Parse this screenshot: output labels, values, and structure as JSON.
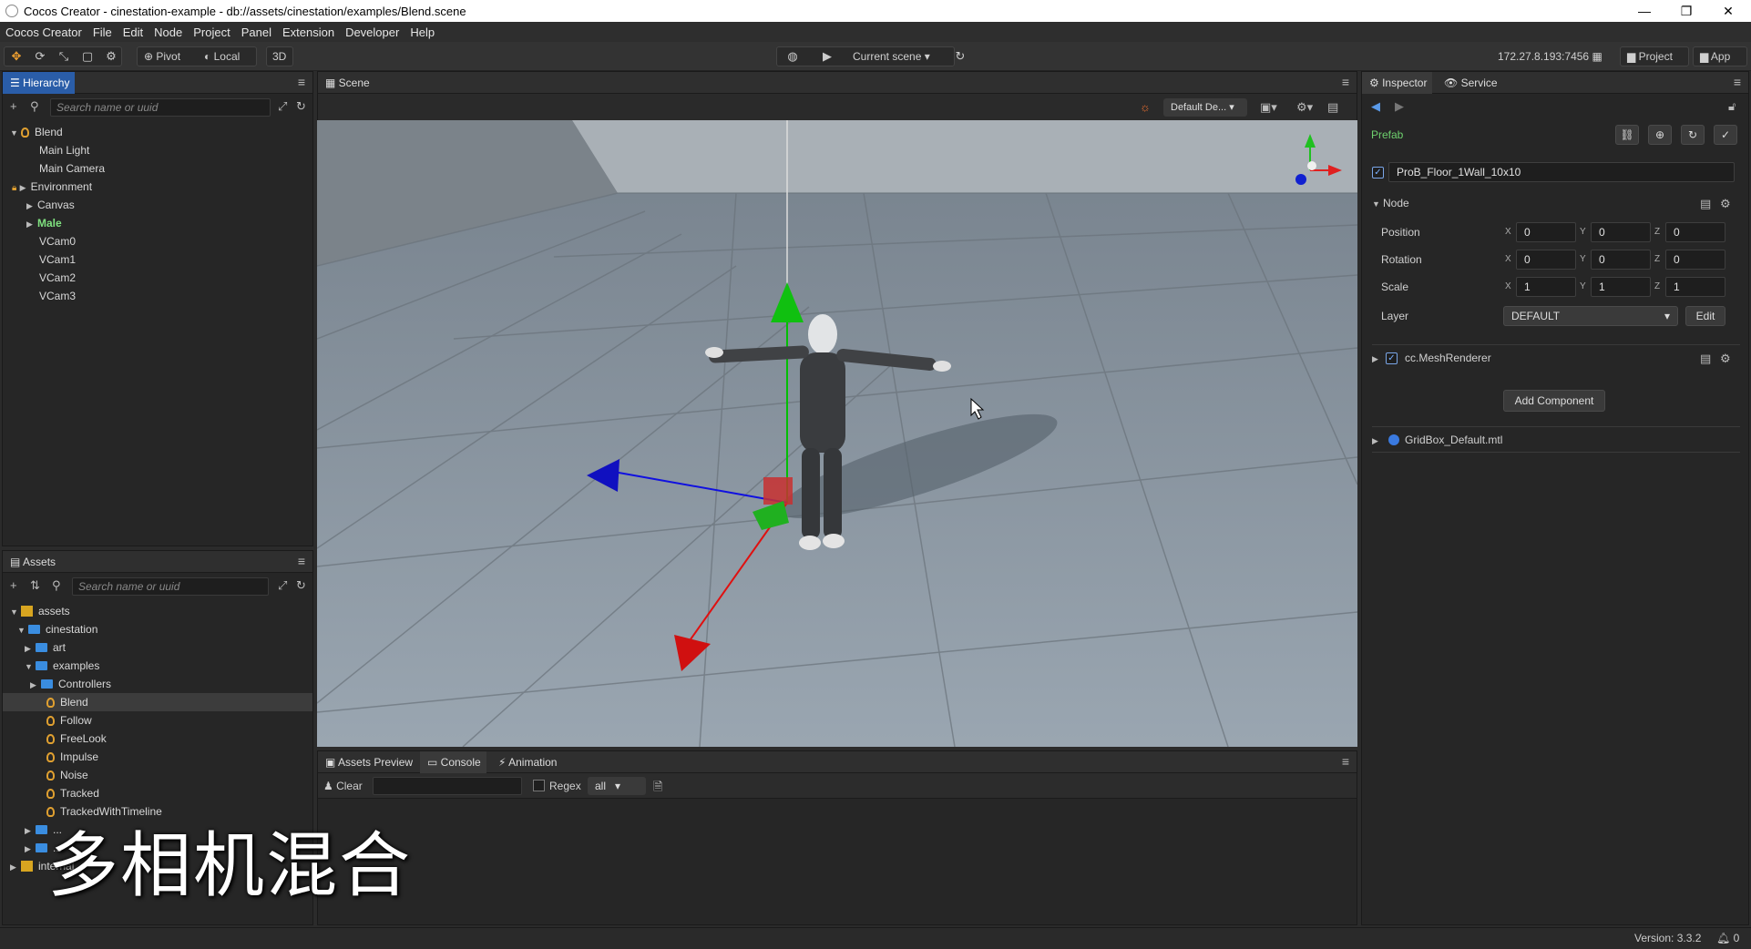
{
  "window": {
    "title": "Cocos Creator - cinestation-example - db://assets/cinestation/examples/Blend.scene",
    "minimize": "—",
    "maximize": "❐",
    "close": "✕"
  },
  "menubar": [
    "Cocos Creator",
    "File",
    "Edit",
    "Node",
    "Project",
    "Panel",
    "Extension",
    "Developer",
    "Help"
  ],
  "toolbar": {
    "pivot": "Pivot",
    "local": "Local",
    "mode3d": "3D",
    "preview_target": "Current scene",
    "ip": "172.27.8.193:7456",
    "project": "Project",
    "app": "App"
  },
  "hierarchy": {
    "tab": "Hierarchy",
    "search_placeholder": "Search name or uuid",
    "items": [
      {
        "label": "Blend"
      },
      {
        "label": "Main Light"
      },
      {
        "label": "Main Camera"
      },
      {
        "label": "Environment"
      },
      {
        "label": "Canvas"
      },
      {
        "label": "Male"
      },
      {
        "label": "VCam0"
      },
      {
        "label": "VCam1"
      },
      {
        "label": "VCam2"
      },
      {
        "label": "VCam3"
      }
    ]
  },
  "assets": {
    "tab": "Assets",
    "search_placeholder": "Search name or uuid",
    "items": [
      {
        "label": "assets"
      },
      {
        "label": "cinestation"
      },
      {
        "label": "art"
      },
      {
        "label": "examples"
      },
      {
        "label": "Controllers"
      },
      {
        "label": "Blend"
      },
      {
        "label": "Follow"
      },
      {
        "label": "FreeLook"
      },
      {
        "label": "Impulse"
      },
      {
        "label": "Noise"
      },
      {
        "label": "Tracked"
      },
      {
        "label": "TrackedWithTimeline"
      },
      {
        "label": "..."
      },
      {
        "label": "..."
      },
      {
        "label": "internal"
      }
    ]
  },
  "scene": {
    "tab": "Scene",
    "camera_select": "Default De..."
  },
  "bottom": {
    "tabs": [
      "Assets Preview",
      "Console",
      "Animation"
    ],
    "clear": "Clear",
    "regex": "Regex",
    "level": "all"
  },
  "inspector": {
    "tab": "Inspector",
    "service_tab": "Service",
    "prefab_label": "Prefab",
    "node_name": "ProB_Floor_1Wall_10x10",
    "node_section": "Node",
    "position": {
      "label": "Position",
      "x": "0",
      "y": "0",
      "z": "0"
    },
    "rotation": {
      "label": "Rotation",
      "x": "0",
      "y": "0",
      "z": "0"
    },
    "scale": {
      "label": "Scale",
      "x": "1",
      "y": "1",
      "z": "1"
    },
    "layer": {
      "label": "Layer",
      "value": "DEFAULT",
      "edit": "Edit"
    },
    "mesh_renderer": "cc.MeshRenderer",
    "add_component": "Add Component",
    "material": "GridBox_Default.mtl"
  },
  "status": {
    "version": "Version: 3.3.2",
    "notifications": "0"
  },
  "overlay_caption": "多相机混合",
  "axis_labels": {
    "x": "X",
    "y": "Y",
    "z": "Z"
  }
}
